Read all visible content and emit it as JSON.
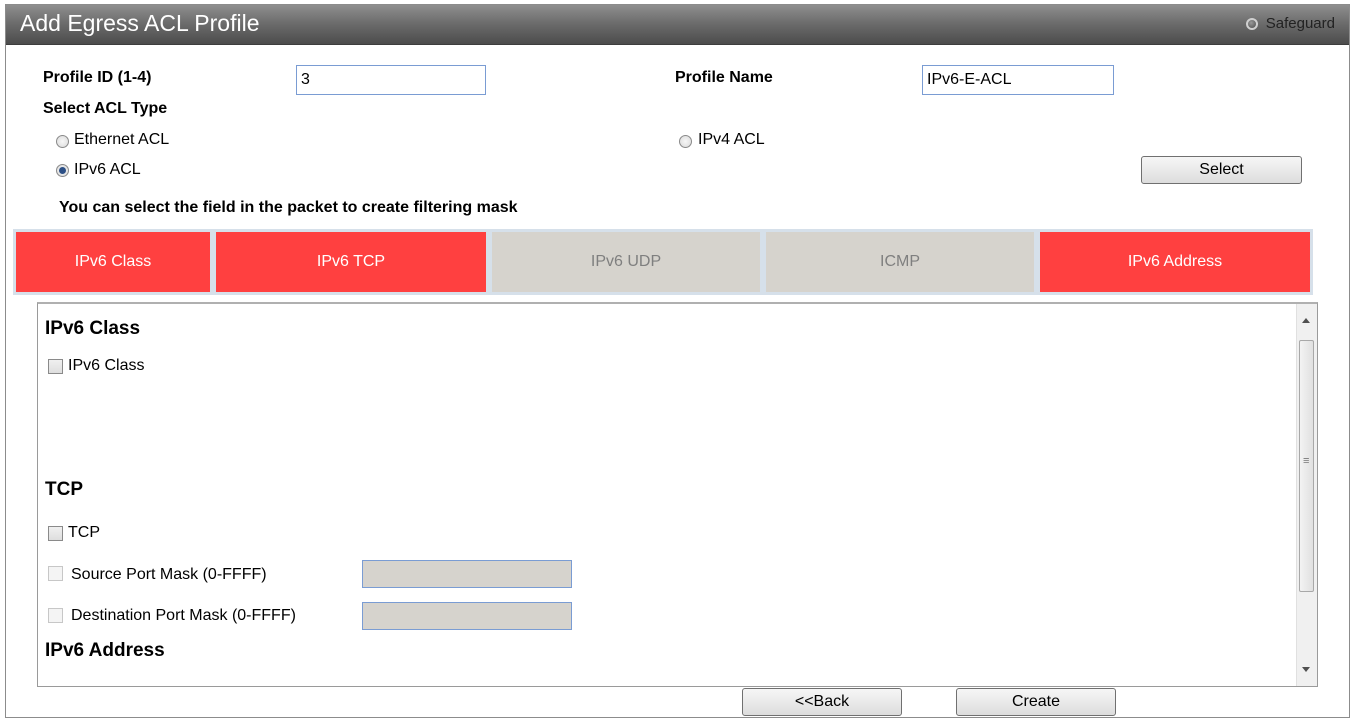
{
  "window": {
    "title": "Add Egress ACL Profile",
    "safeguard_label": "Safeguard"
  },
  "form": {
    "profile_id_label": "Profile ID (1-4)",
    "profile_id_value": "3",
    "profile_name_label": "Profile Name",
    "profile_name_value": "IPv6-E-ACL",
    "select_acl_type_label": "Select ACL Type",
    "acl_types": [
      {
        "label": "Ethernet ACL",
        "selected": false
      },
      {
        "label": "IPv4 ACL",
        "selected": false
      },
      {
        "label": "IPv6 ACL",
        "selected": true
      }
    ],
    "select_button": "Select",
    "hint": "You can select the field in the packet to create filtering mask"
  },
  "tabs": [
    {
      "label": "IPv6 Class",
      "active": true
    },
    {
      "label": "IPv6 TCP",
      "active": true
    },
    {
      "label": "IPv6 UDP",
      "active": false
    },
    {
      "label": "ICMP",
      "active": false
    },
    {
      "label": "IPv6 Address",
      "active": true
    }
  ],
  "colors": {
    "active_tab": "#ff4040",
    "inactive_tab": "#d6d3cd",
    "tab_border": "#d6e0ea",
    "titlebar": "#5a5a5a"
  },
  "panel": {
    "ipv6_class": {
      "heading": "IPv6 Class",
      "checkbox_label": "IPv6 Class"
    },
    "tcp": {
      "heading": "TCP",
      "checkbox_label": "TCP",
      "source_port_label": "Source Port Mask (0-FFFF)",
      "destination_port_label": "Destination Port Mask (0-FFFF)"
    },
    "ipv6_address": {
      "heading": "IPv6 Address"
    }
  },
  "footer": {
    "back_button": "<<Back",
    "create_button": "Create"
  }
}
